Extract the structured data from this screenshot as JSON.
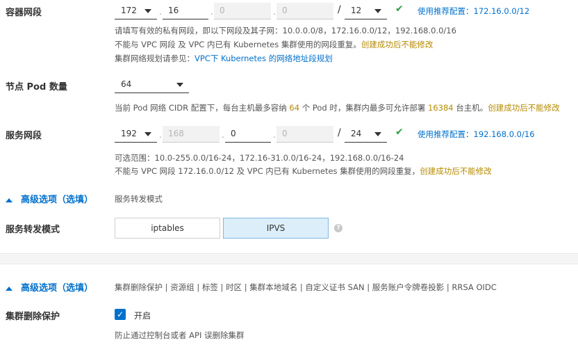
{
  "container_cidr": {
    "label": "容器网段",
    "octet1": "172",
    "octet2": "16",
    "octet3": "0",
    "octet4": "0",
    "mask": "12",
    "recommend": "使用推荐配置：172.16.0.0/12",
    "help1": "请填写有效的私有网段，即以下网段及其子网：10.0.0.0/8，172.16.0.0/12，192.168.0.0/16",
    "help2_prefix": "不能与 VPC 网段 及 VPC 内已有 Kubernetes 集群使用的网段重复。",
    "help2_warn": "创建成功后不能修改",
    "help3_prefix": "集群网络规划请参见：",
    "help3_link": "VPC下 Kubernetes 的网络地址段规划"
  },
  "node_pod": {
    "label": "节点 Pod 数量",
    "value": "64",
    "help_a": "当前 Pod 网络 CIDR 配置下，每台主机最多容纳 ",
    "help_num1": "64",
    "help_b": " 个 Pod 时，集群内最多可允许部署 ",
    "help_num2": "16384",
    "help_c": " 台主机。",
    "help_warn": "创建成功后不能修改"
  },
  "service_cidr": {
    "label": "服务网段",
    "octet1": "192",
    "octet2": "168",
    "octet3": "0",
    "octet4": "0",
    "mask": "24",
    "recommend": "使用推荐配置：192.168.0.0/16",
    "help1": "可选范围：10.0-255.0.0/16-24，172.16-31.0.0/16-24，192.168.0.0/16-24",
    "help2_prefix": "不能与 VPC 网段 172.16.0.0/12 及 VPC 内已有 Kubernetes 集群使用的网段重复，",
    "help2_warn": "创建成功后不能修改"
  },
  "advanced1": {
    "label": "高级选项（选填）",
    "desc": "服务转发模式"
  },
  "proxy_mode": {
    "label": "服务转发模式",
    "opt1": "iptables",
    "opt2": "IPVS",
    "selected": "IPVS",
    "help_icon": "?"
  },
  "advanced2": {
    "label": "高级选项（选填）",
    "desc": "集群删除保护 | 资源组 | 标签 | 时区 | 集群本地域名 | 自定义证书 SAN | 服务账户令牌卷投影 | RRSA OIDC"
  },
  "delete_protection": {
    "label": "集群删除保护",
    "checkbox_label": "开启",
    "checked": true,
    "help": "防止通过控制台或者 API 误删除集群"
  },
  "colors": {
    "accent": "#0070cc",
    "warn": "#b58a00",
    "ok": "#2ea043"
  },
  "icons": {
    "caret": "chevron-down-icon",
    "check": "check-icon",
    "collapse": "chevron-up-icon",
    "help": "help-icon"
  }
}
